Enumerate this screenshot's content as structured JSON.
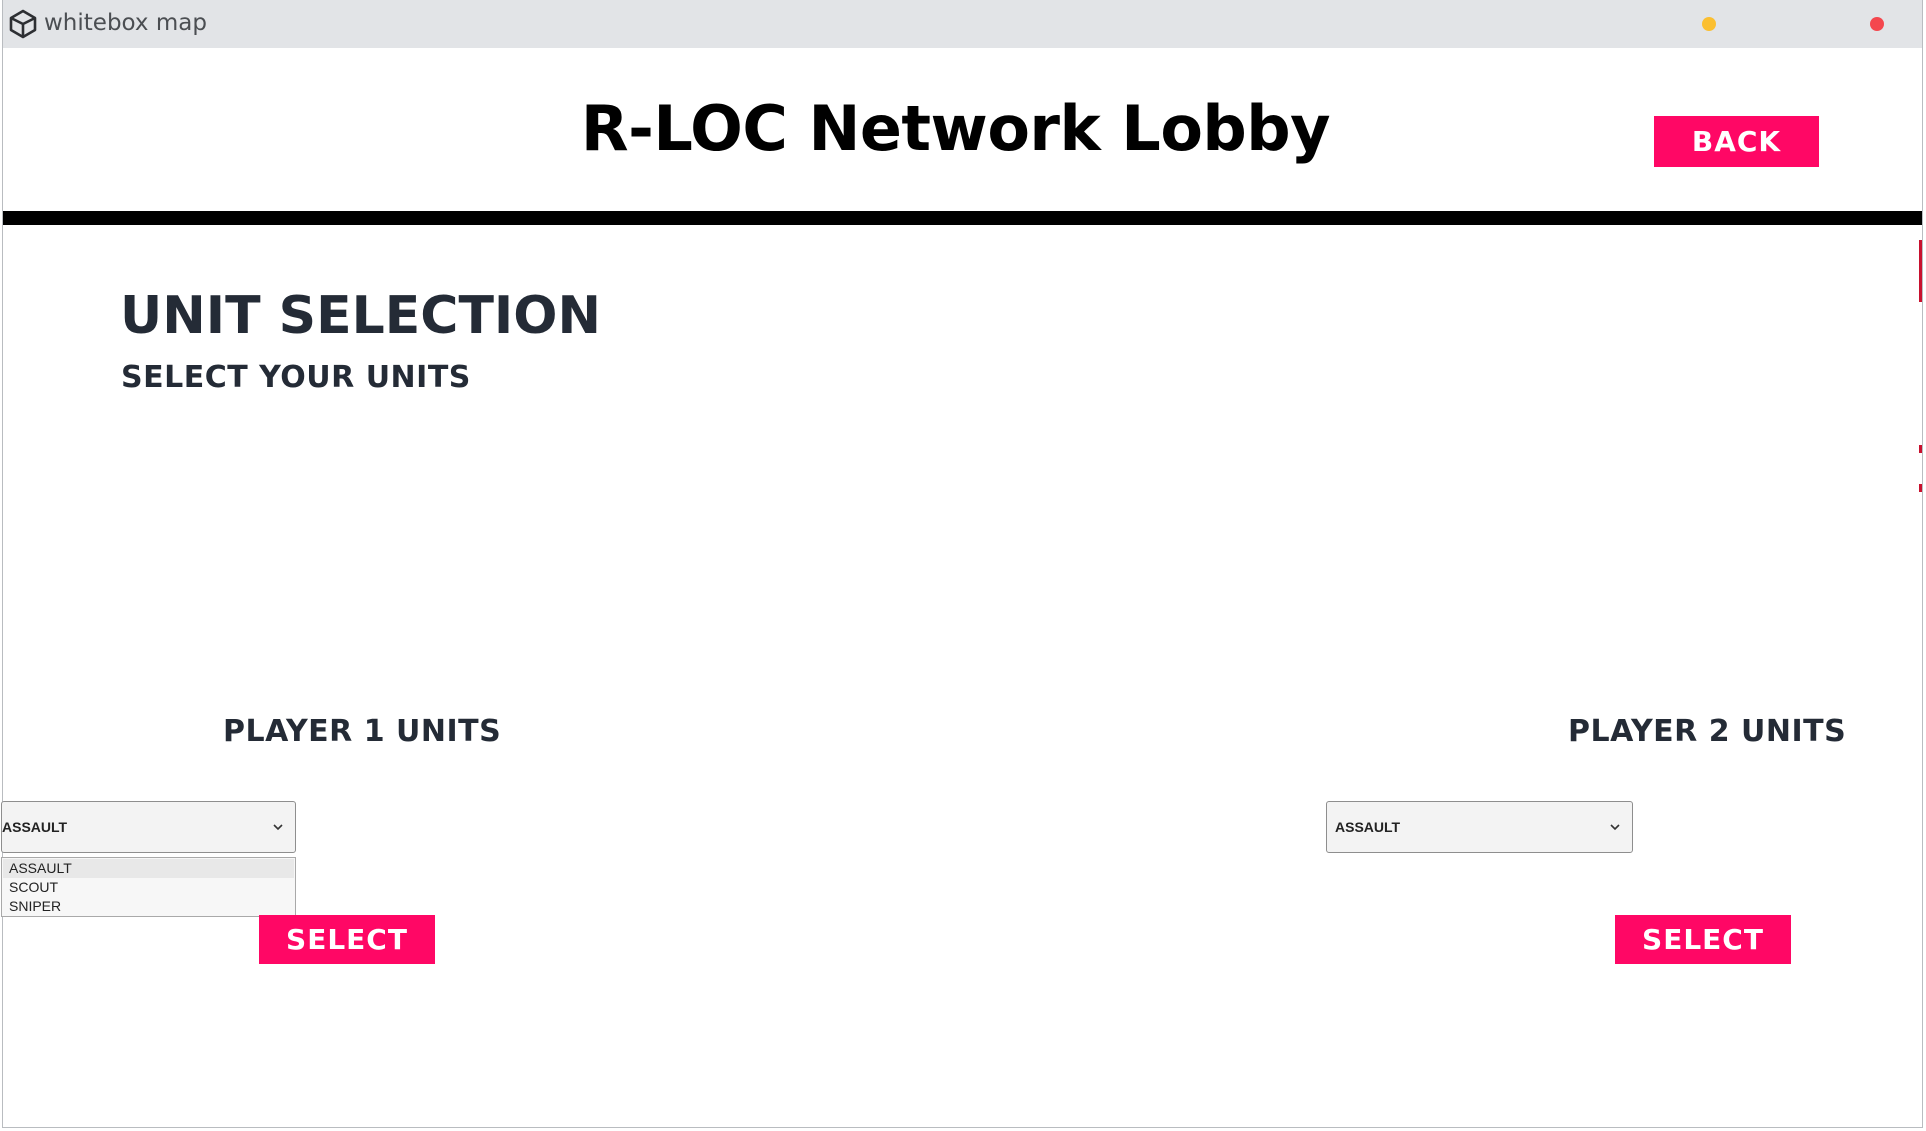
{
  "window": {
    "title": "whitebox map"
  },
  "header": {
    "title": "R-LOC Network Lobby",
    "back_label": "BACK"
  },
  "unit_selection": {
    "title": "UNIT SELECTION",
    "subtitle": "SELECT YOUR UNITS"
  },
  "player1": {
    "heading": "PLAYER 1 UNITS",
    "selected_unit": "ASSAULT",
    "options": [
      "ASSAULT",
      "SCOUT",
      "SNIPER"
    ],
    "select_label": "SELECT"
  },
  "player2": {
    "heading": "PLAYER 2 UNITS",
    "selected_unit": "ASSAULT",
    "select_label": "SELECT"
  },
  "colors": {
    "accent": "#ff0765",
    "heading_text": "#242b36",
    "titlebar": "#e2e4e7",
    "minimize": "#fbbf31",
    "close": "#f4474e"
  },
  "icons": {
    "app": "unity-logo-icon",
    "dropdown": "chevron-down-icon"
  }
}
